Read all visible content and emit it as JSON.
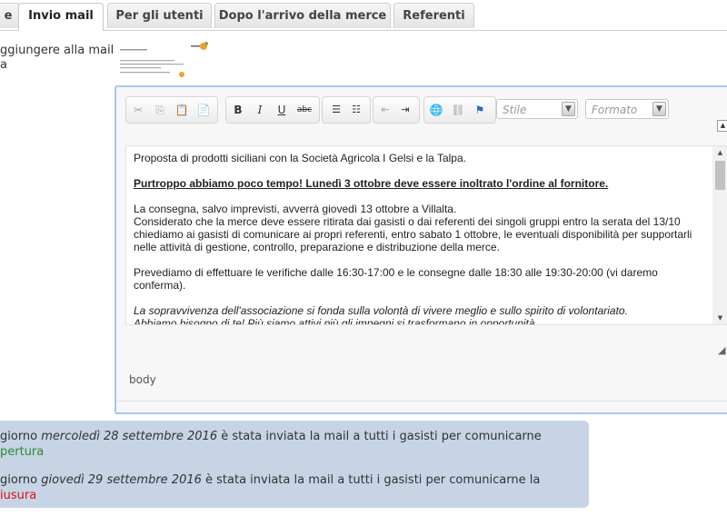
{
  "tabs": [
    {
      "label": "e"
    },
    {
      "label": "Invio mail"
    },
    {
      "label": "Per gli utenti"
    },
    {
      "label": "Dopo l'arrivo della merce"
    },
    {
      "label": "Referenti"
    }
  ],
  "left_label": {
    "line1": "ggiungere alla mail",
    "line2": "a"
  },
  "toolbar": {
    "style_combo": "Stile",
    "format_combo": "Formato"
  },
  "email": {
    "p1": "Proposta di prodotti siciliani con la Società Agricola I Gelsi e la Talpa.",
    "p2": "Purtroppo abbiamo poco tempo! Lunedì 3 ottobre deve essere inoltrato l'ordine al fornitore.",
    "p3a": "La consegna, salvo imprevisti, avverrà giovedì 13 ottobre a Villalta.",
    "p3b": "Considerato che la merce deve essere ritirata dai gasisti o dai referenti dei singoli gruppi entro la serata del 13/10 chiediamo ai gasisti di comunicare ai propri referenti, entro sabato 1 ottobre, le eventuali disponibilità per supportarli nelle attività di gestione, controllo, preparazione e distribuzione della merce.",
    "p4": "Prevediamo di effettuare le verifiche dalle 16:30-17:00 e le consegne dalle 18:30 alle 19:30-20:00 (vi daremo conferma).",
    "p5a": "La sopravvivenza dell'associazione si fonda sulla volontà di vivere meglio e sullo spirito di volontariato.",
    "p5b": "Abbiamo bisogno di te!    Più siamo attivi più gli impegni si trasformano in opportunità"
  },
  "path": "body",
  "notices": {
    "n1_pre": "giorno ",
    "n1_date": "mercoledì 28 settembre 2016",
    "n1_post": " è stata inviata la mail a tutti i gasisti per comunicarne",
    "n1_state": "pertura",
    "n2_pre": "giorno ",
    "n2_date": "giovedì 29 settembre 2016",
    "n2_post": " è stata inviata la mail a tutti i gasisti per comunicarne la",
    "n2_state": "iusura"
  },
  "colors": {
    "open": "#2e8b2e",
    "closed": "#dd1111",
    "editor_border": "#a9c7f0",
    "notice_bg": "#c6d4e6"
  }
}
